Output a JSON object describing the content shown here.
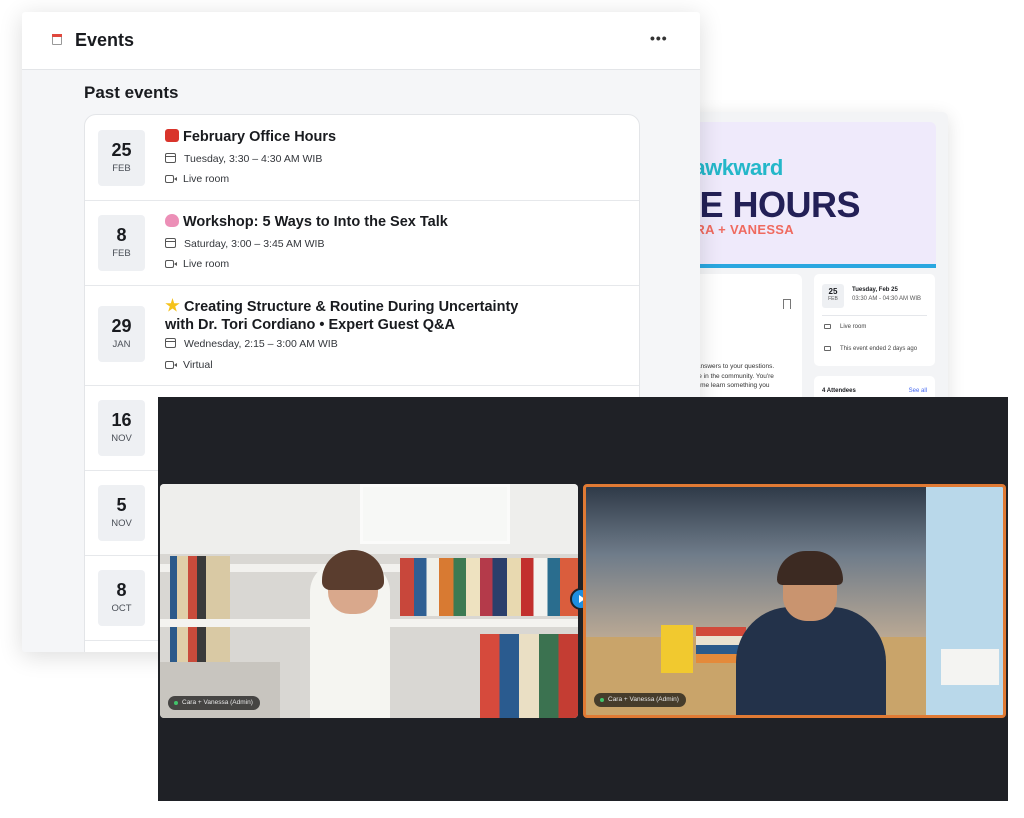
{
  "detail_card": {
    "banner": {
      "line1": "s awkward",
      "line2": "CE HOURS",
      "line3": "CARA + VANESSA"
    },
    "about_text": [
      "get answers to your questions.",
      "eople in the community. You're",
      "... come learn something you"
    ],
    "date_day": "25",
    "date_month": "FEB",
    "date_line1": "Tuesday, Feb 25",
    "date_line2": "03:30 AM - 04:30 AM WIB",
    "location": "Live room",
    "status": "This event ended 2 days ago",
    "attendees_label": "4 Attendees",
    "see_all": "See all"
  },
  "events": {
    "title": "Events",
    "more_label": "•••",
    "section_title": "Past events",
    "items": [
      {
        "day": "25",
        "month": "FEB",
        "emoji": "phone-icon",
        "title": "February Office Hours",
        "time": "Tuesday, 3:30 – 4:30 AM WIB",
        "location": "Live room"
      },
      {
        "day": "8",
        "month": "FEB",
        "emoji": "brain-icon",
        "title": "Workshop: 5 Ways to Into the Sex Talk",
        "time": "Saturday, 3:00 – 3:45 AM WIB",
        "location": "Live room"
      },
      {
        "day": "29",
        "month": "JAN",
        "emoji": "star-icon",
        "title": "Creating Structure & Routine During Uncertainty",
        "title_line2": "with Dr. Tori Cordiano • Expert Guest Q&A",
        "time": "Wednesday, 2:15 – 3:00 AM WIB",
        "location": "Virtual"
      },
      {
        "day": "16",
        "month": "NOV"
      },
      {
        "day": "5",
        "month": "NOV"
      },
      {
        "day": "8",
        "month": "OCT"
      }
    ]
  },
  "video_call": {
    "left_participant": "Cara + Vanessa (Admin)",
    "right_participant": "Cara + Vanessa (Admin)",
    "active_speaker_color": "#e07a34"
  }
}
